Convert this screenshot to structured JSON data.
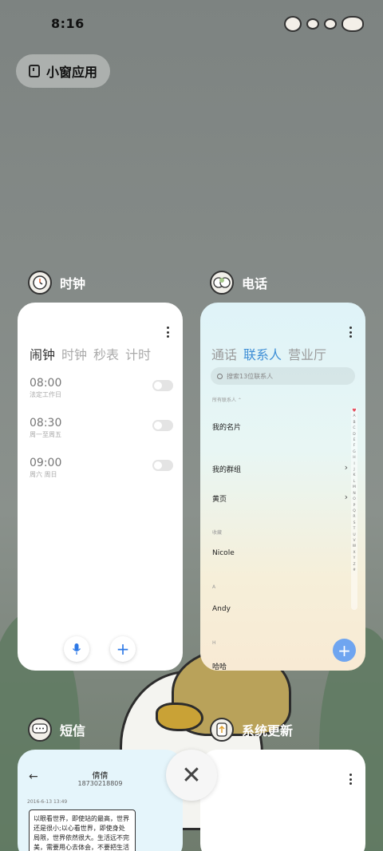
{
  "status_bar": {
    "time": "8:16"
  },
  "floating_window_button": {
    "label": "小窗应用"
  },
  "apps": {
    "clock": {
      "title": "时钟",
      "tabs": [
        "闹钟",
        "时钟",
        "秒表",
        "计时"
      ],
      "alarms": [
        {
          "time": "08:00",
          "repeat": "法定工作日"
        },
        {
          "time": "08:30",
          "repeat": "周一至周五"
        },
        {
          "time": "09:00",
          "repeat": "周六 周日"
        }
      ]
    },
    "phone": {
      "title": "电话",
      "tabs": [
        "通话",
        "联系人",
        "营业厅"
      ],
      "search_placeholder": "搜索13位联系人",
      "filter_label": "所有联系人",
      "rows": {
        "my_card": "我的名片",
        "my_groups": "我的群组",
        "yellow_pages": "黄页",
        "favorites_header": "收藏",
        "fav_contact": "Nicole",
        "section_a": "A",
        "contact_a": "Andy",
        "section_h": "H",
        "contact_h": "哈哈"
      },
      "alphabet": [
        "A",
        "B",
        "C",
        "D",
        "E",
        "F",
        "G",
        "H",
        "I",
        "J",
        "K",
        "L",
        "M",
        "N",
        "O",
        "P",
        "Q",
        "R",
        "S",
        "T",
        "U",
        "V",
        "W",
        "X",
        "Y",
        "Z",
        "#"
      ]
    },
    "messages": {
      "title": "短信",
      "contact_name": "倩倩",
      "contact_number": "18730218809",
      "date": "2016-6-13 13:49",
      "message_text": "以眼看世界，即使站的最高，世界还是很小;以心看世界，即使身处局限，世界依然很大。生活远不完美，需要用心去体会，不要把生活"
    },
    "system_update": {
      "title": "系统更新"
    }
  },
  "colors": {
    "phone_accent": "#3f8fd6",
    "clock_fab": "#2d78e6",
    "phone_fab": "#6fa5f0"
  }
}
